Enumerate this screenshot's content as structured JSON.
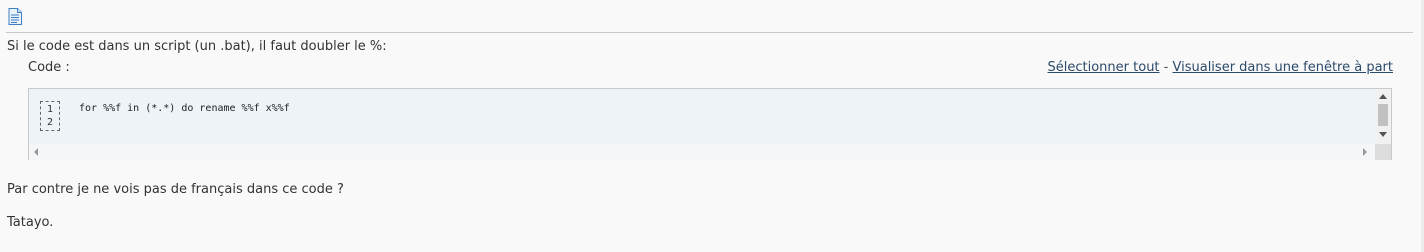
{
  "post": {
    "intro": "Si le code est dans un script (un .bat), il faut doubler le %:",
    "code_label": "Code :",
    "select_all": "Sélectionner tout",
    "separator": " - ",
    "view_window": "Visualiser dans une fenêtre à part",
    "line_numbers": [
      "1",
      "2"
    ],
    "code_line_1": "for %%f in (*.*) do rename %%f x%%f",
    "question": "Par contre je ne vois pas de français dans ce code ?",
    "signature": "Tatayo."
  },
  "icons": {
    "document": "document-icon"
  },
  "colors": {
    "link": "#2c4a6a",
    "code_bg": "#eef3f8",
    "page_bg": "#f9f9f9"
  }
}
